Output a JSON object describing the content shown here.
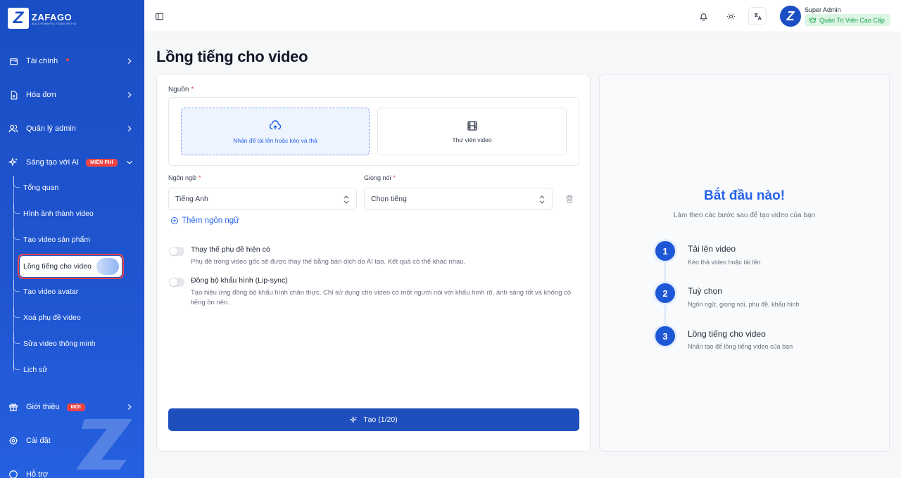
{
  "brand": {
    "logo_letter": "Z",
    "name": "ZAFAGO",
    "tagline": "BUILD POWERFUL TEAMS WITH AI"
  },
  "sidebar": {
    "items": [
      {
        "label": "Tài chính",
        "icon": "wallet-icon"
      },
      {
        "label": "Hóa đơn",
        "icon": "invoice-icon"
      },
      {
        "label": "Quản lý admin",
        "icon": "users-icon"
      },
      {
        "label": "Sáng tạo với AI",
        "icon": "sparkles-icon",
        "badge": "MIỄN PHÍ"
      },
      {
        "label": "Giới thiệu",
        "icon": "gift-icon",
        "badge": "MỚI"
      },
      {
        "label": "Cài đặt",
        "icon": "settings-icon"
      },
      {
        "label": "Hỗ trợ",
        "icon": "help-icon"
      }
    ],
    "ai_subitems": [
      "Tổng quan",
      "Hình ảnh thành video",
      "Tạo video sản phẩm",
      "Lồng tiếng cho video",
      "Tạo video avatar",
      "Xoá phụ đề video",
      "Sửa video thông minh",
      "Lịch sử"
    ],
    "active_subitem": "Lồng tiếng cho video"
  },
  "topbar": {
    "user_initial": "Z",
    "user_name": "Super Admin",
    "user_role": "Quản Trị Viên Cao Cấp"
  },
  "page": {
    "title": "Lồng tiếng cho video",
    "source_label": "Nguồn",
    "upload_text": "Nhấn để tải lên hoặc kéo và thả",
    "library_text": "Thư viện video",
    "language_label": "Ngôn ngữ",
    "language_value": "Tiếng Anh",
    "voice_label": "Giọng nói",
    "voice_value": "Chọn tiếng",
    "add_language": "Thêm ngôn ngữ",
    "option1_title": "Thay thế phụ đề hiện có",
    "option1_desc": "Phụ đề trong video gốc sẽ được thay thế bằng bản dịch do AI tạo. Kết quả có thể khác nhau.",
    "option1_on": false,
    "option2_title": "Đồng bộ khẩu hình (Lip-sync)",
    "option2_desc": "Tạo hiệu ứng đồng bộ khẩu hình chân thực. Chỉ sử dụng cho video có một người nói với khẩu hình rõ, ánh sáng tốt và không có tiếng ồn nền.",
    "option2_on": false,
    "create_button": "Tạo (1/20)"
  },
  "guide": {
    "title": "Bắt đầu nào!",
    "subtitle": "Làm theo các bước sau để tạo video của bạn",
    "steps": [
      {
        "num": "1",
        "title": "Tải lên video",
        "desc": "Kéo thả video hoặc tải lên"
      },
      {
        "num": "2",
        "title": "Tuỳ chọn",
        "desc": "Ngôn ngữ, giọng nói, phụ đề, khẩu hình"
      },
      {
        "num": "3",
        "title": "Lồng tiếng cho video",
        "desc": "Nhấn tạo để lồng tiếng video của bạn"
      }
    ]
  },
  "colors": {
    "primary": "#1e4fbd",
    "accent": "#2563eb",
    "badge": "#ef4444",
    "role_bg": "#dcf5e4",
    "role_text": "#16a34a"
  }
}
